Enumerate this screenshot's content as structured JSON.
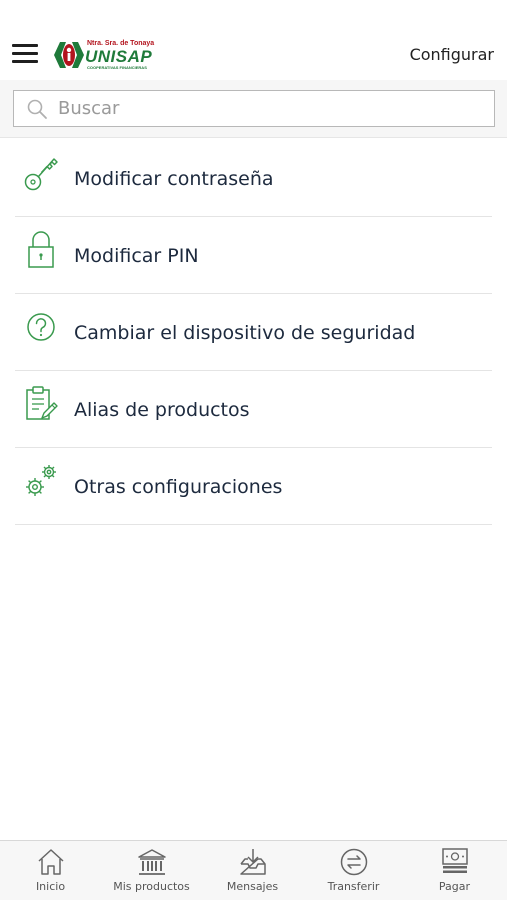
{
  "header": {
    "logo": {
      "tagline_top": "Ntra. Sra. de Tonaya",
      "name": "UNISAP",
      "tagline_bottom": "COOPERATIVAS FINANCIERAS"
    },
    "action_label": "Configurar"
  },
  "search": {
    "placeholder": "Buscar",
    "value": ""
  },
  "settings_list": {
    "items": [
      {
        "label": "Modificar contraseña",
        "icon": "key-icon"
      },
      {
        "label": "Modificar PIN",
        "icon": "lock-icon"
      },
      {
        "label": "Cambiar el dispositivo de seguridad",
        "icon": "question-circle-icon"
      },
      {
        "label": "Alias de productos",
        "icon": "clipboard-edit-icon"
      },
      {
        "label": "Otras configuraciones",
        "icon": "gears-icon"
      }
    ]
  },
  "bottom_nav": {
    "items": [
      {
        "label": "Inicio",
        "icon": "home-icon"
      },
      {
        "label": "Mis productos",
        "icon": "bank-icon"
      },
      {
        "label": "Mensajes",
        "icon": "inbox-icon"
      },
      {
        "label": "Transferir",
        "icon": "transfer-icon"
      },
      {
        "label": "Pagar",
        "icon": "payment-icon"
      }
    ]
  },
  "colors": {
    "icon_green": "#3a9a4e",
    "brand_red": "#b3141e",
    "brand_green": "#1f7a3a",
    "text_dark": "#1d2a3e"
  }
}
